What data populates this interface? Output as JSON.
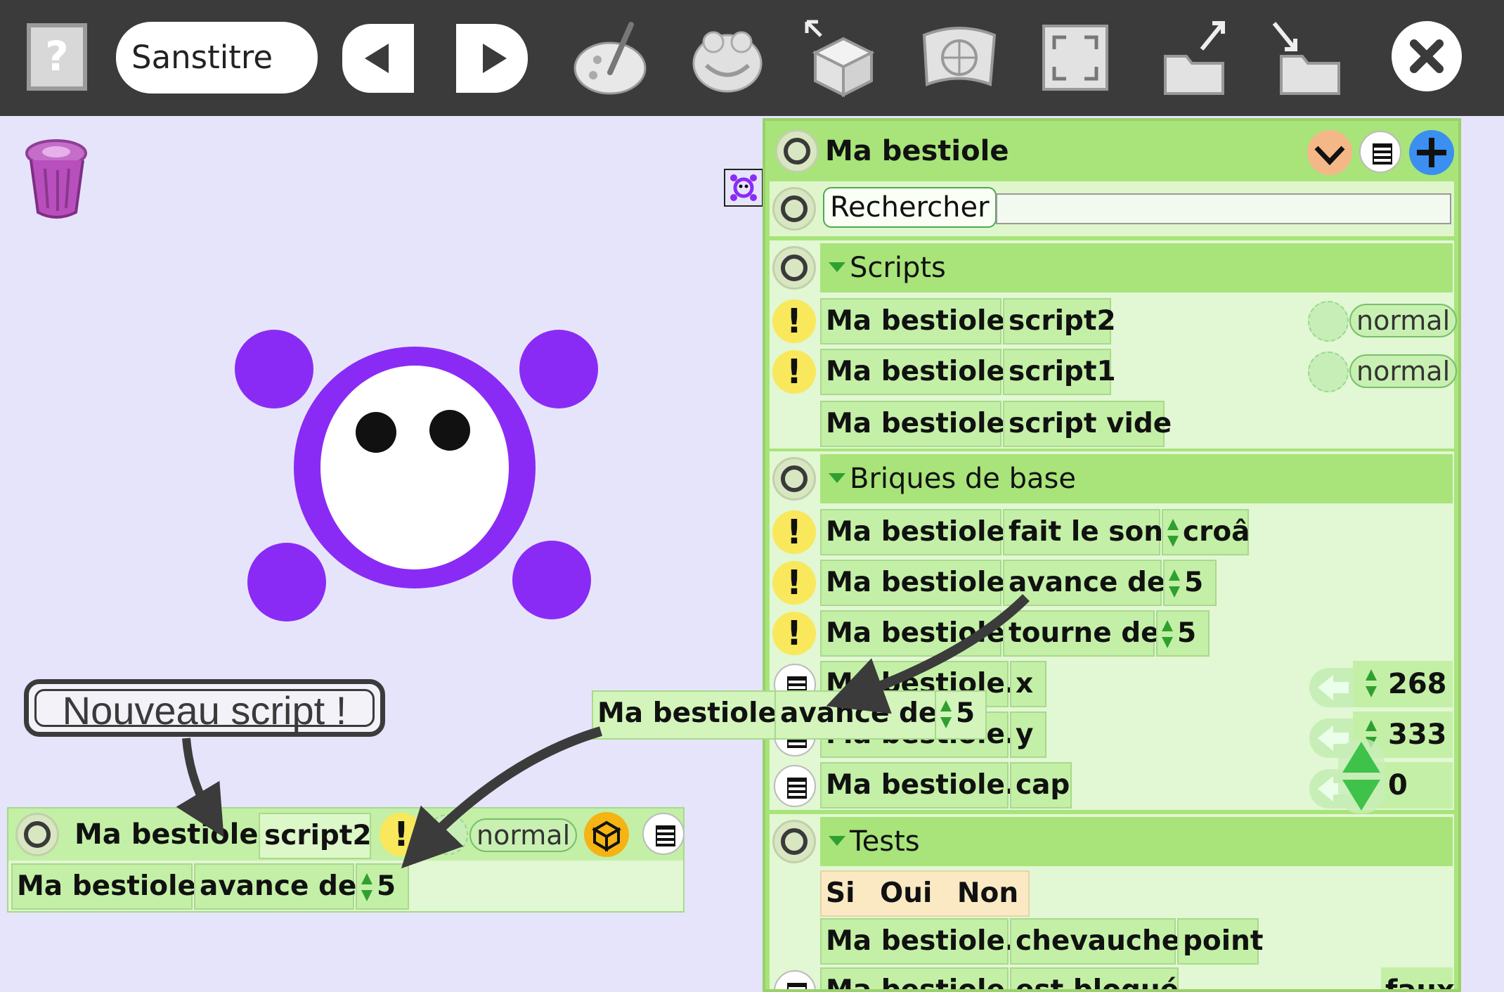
{
  "toolbar": {
    "help_label": "?",
    "project_title": "Sanstitre",
    "buttons": [
      "back",
      "forward",
      "paint",
      "frog-viewer",
      "object-catalog",
      "world-map",
      "fullscreen",
      "export",
      "import",
      "close"
    ]
  },
  "bubble": {
    "text": "Nouveau script !"
  },
  "panel": {
    "object_name": "Ma bestiole",
    "search_label": "Rechercher",
    "search_value": "",
    "sections": {
      "scripts": {
        "title": "Scripts",
        "rows": [
          {
            "object": "Ma bestiole",
            "command": "script2",
            "status": "normal"
          },
          {
            "object": "Ma bestiole",
            "command": "script1",
            "status": "normal"
          },
          {
            "object": "Ma bestiole",
            "command": "script vide"
          }
        ]
      },
      "basics": {
        "title": "Briques de base",
        "rows": [
          {
            "object": "Ma bestiole",
            "command": "fait le son",
            "arg": "croâ"
          },
          {
            "object": "Ma bestiole",
            "command": "avance de",
            "arg": "5"
          },
          {
            "object": "Ma bestiole",
            "command": "tourne de",
            "arg": "5"
          },
          {
            "object": "Ma bestiole.",
            "command": "x",
            "value": "268"
          },
          {
            "object": "Ma bestiole.",
            "command": "y",
            "value": "333"
          },
          {
            "object": "Ma bestiole.",
            "command": "cap",
            "value": "0"
          }
        ]
      },
      "tests": {
        "title": "Tests",
        "if_tile": {
          "si": "Si",
          "oui": "Oui",
          "non": "Non"
        },
        "rows": [
          {
            "object": "Ma bestiole.",
            "command": "chevauche",
            "arg": "point"
          },
          {
            "object": "Ma bestiole",
            "command": "est bloqué",
            "value": "faux"
          }
        ]
      }
    }
  },
  "dragged_tile": {
    "object": "Ma bestiole",
    "command": "avance de",
    "arg": "5"
  },
  "script_editor": {
    "object": "Ma bestiole",
    "script_name": "script2",
    "status": "normal",
    "body": {
      "object": "Ma bestiole",
      "command": "avance de",
      "arg": "5"
    }
  },
  "colors": {
    "toolbar": "#3b3b3b",
    "world": "#e6e4fa",
    "creature": "#8a2bf5",
    "tile": "#c3f0a6",
    "panel": "#a8e47a",
    "warning": "#f9e85c"
  }
}
